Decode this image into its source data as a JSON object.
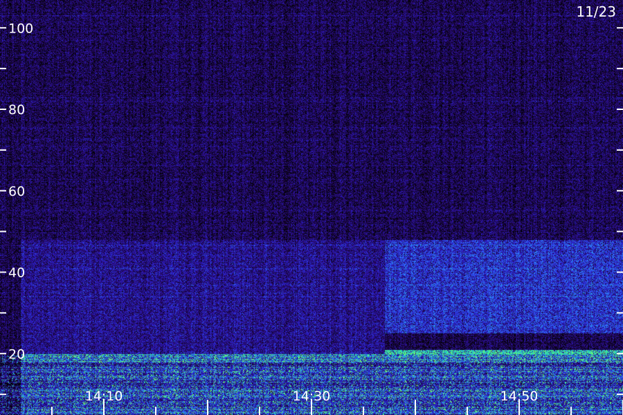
{
  "chart_data": {
    "type": "heatmap",
    "title": "",
    "xlabel": "",
    "ylabel": "",
    "date_label": "11/23",
    "y_axis": {
      "range": [
        0,
        110
      ],
      "labeled_ticks": [
        20,
        40,
        60,
        80,
        100
      ],
      "ticks": [
        0,
        10,
        20,
        30,
        40,
        50,
        60,
        70,
        80,
        90,
        100
      ]
    },
    "x_axis": {
      "range": [
        "14:02",
        "15:02"
      ],
      "labeled_ticks": [
        "14:10",
        "14:30",
        "14:50"
      ],
      "minor_tick_interval_minutes": 5
    },
    "colormap": [
      "#000000",
      "#2a0a6e",
      "#2b1fd0",
      "#2f7fff",
      "#1fe0b0",
      "#7dff60"
    ],
    "intensity_regions": [
      {
        "x_range": [
          "14:02",
          "15:02"
        ],
        "y_range": [
          18,
          21
        ],
        "level": "high"
      },
      {
        "x_range": [
          "14:02",
          "15:02"
        ],
        "y_range": [
          0,
          18
        ],
        "level": "medium-high"
      },
      {
        "x_range": [
          "14:37",
          "15:02"
        ],
        "y_range": [
          25,
          48
        ],
        "level": "medium"
      },
      {
        "x_range": [
          "14:02",
          "14:37"
        ],
        "y_range": [
          20,
          48
        ],
        "level": "low-medium"
      },
      {
        "x_range": [
          "14:02",
          "15:02"
        ],
        "y_range": [
          48,
          110
        ],
        "level": "low"
      }
    ]
  }
}
